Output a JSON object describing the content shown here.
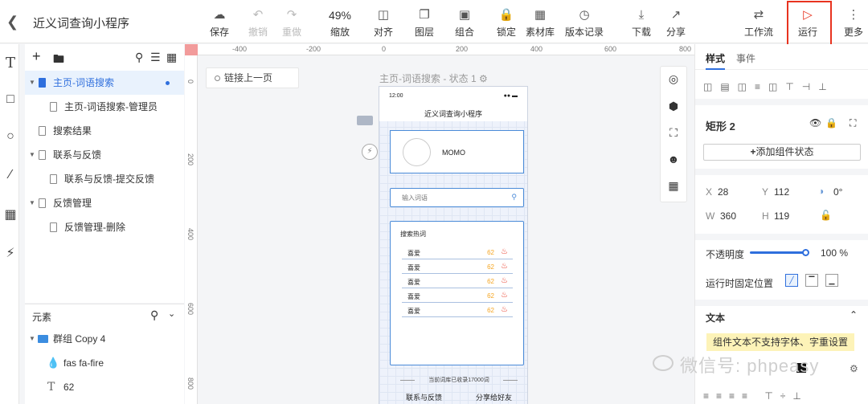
{
  "app": {
    "title": "近义词查询小程序"
  },
  "toolbar": {
    "save": "保存",
    "undo": "撤销",
    "redo": "重做",
    "zoom_value": "49%",
    "zoom": "缩放",
    "align": "对齐",
    "layer": "图层",
    "group": "组合",
    "lock": "锁定",
    "assets": "素材库",
    "version": "版本记录",
    "download": "下载",
    "share": "分享",
    "workflow": "工作流",
    "run": "运行",
    "more": "更多"
  },
  "pages": {
    "items": [
      {
        "label": "主页-词语搜索"
      },
      {
        "label": "主页-词语搜索-管理员"
      },
      {
        "label": "搜索结果"
      },
      {
        "label": "联系与反馈"
      },
      {
        "label": "联系与反馈-提交反馈"
      },
      {
        "label": "反馈管理"
      },
      {
        "label": "反馈管理-删除"
      }
    ]
  },
  "elements": {
    "title": "元素",
    "items": [
      {
        "label": "群组 Copy 4"
      },
      {
        "label": "fas fa-fire"
      },
      {
        "label": "62"
      }
    ]
  },
  "ruler": {
    "h": [
      "-400",
      "-200",
      "0",
      "200",
      "400",
      "600",
      "800"
    ],
    "v": [
      "0",
      "200",
      "400",
      "600",
      "800"
    ]
  },
  "canvas": {
    "link_prev": "链接上一页",
    "state_label": "主页-词语搜索 - 状态 1",
    "phone": {
      "time": "12:00",
      "title": "近义词查询小程序",
      "momo": "MOMO",
      "search_placeholder": "输入词语",
      "hot_title": "搜索热词",
      "hot_rows": [
        {
          "word": "喜爱",
          "num": "62"
        },
        {
          "word": "喜爱",
          "num": "62"
        },
        {
          "word": "喜爱",
          "num": "62"
        },
        {
          "word": "喜爱",
          "num": "62"
        },
        {
          "word": "喜爱",
          "num": "62"
        }
      ],
      "stat": "当前词库已收录17000词",
      "btn_left": "联系与反馈",
      "btn_right": "分享给好友"
    }
  },
  "inspector": {
    "tab_style": "样式",
    "tab_event": "事件",
    "name": "矩形 2",
    "add_state": "添加组件状态",
    "x_label": "X",
    "x": "28",
    "y_label": "Y",
    "y": "112",
    "rot": "0°",
    "w_label": "W",
    "w": "360",
    "h_label": "H",
    "h": "119",
    "opacity_label": "不透明度",
    "opacity": "100 %",
    "fixed_label": "运行时固定位置",
    "text_section": "文本",
    "warn": "组件文本不支持字体、字重设置"
  },
  "watermark": "微信号: phpeasy",
  "colors": {
    "accent": "#2f6fdd",
    "run_highlight": "#e8331f",
    "hot_num": "#f5a623",
    "fire": "#e8331f"
  }
}
